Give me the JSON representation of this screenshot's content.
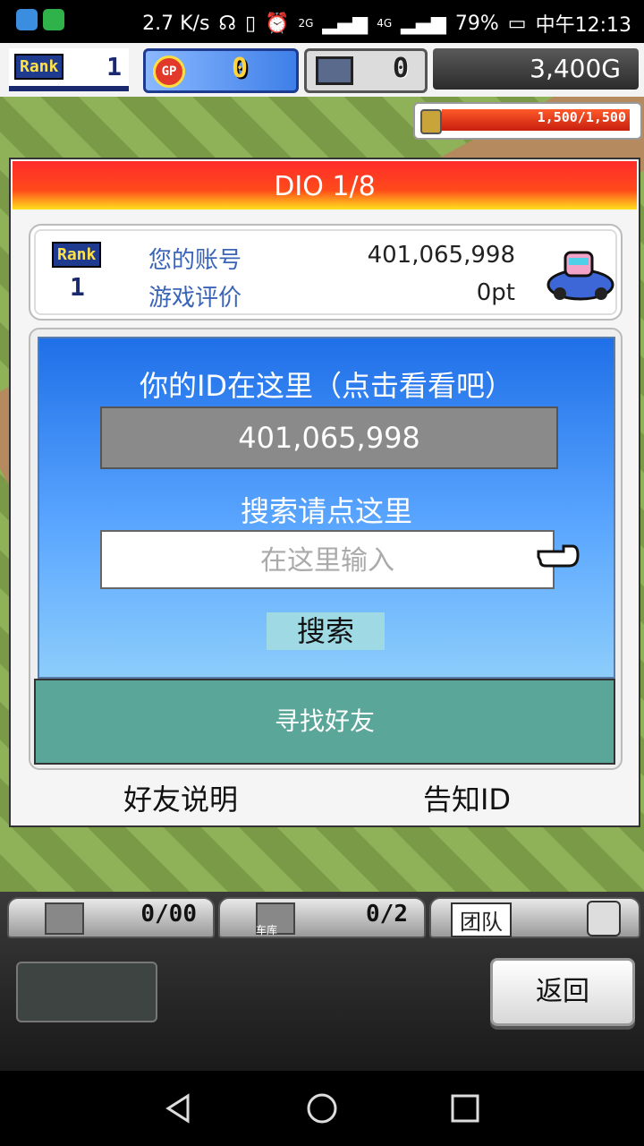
{
  "status_bar": {
    "speed": "2.7 K/s",
    "network1": "2G",
    "network2": "4G",
    "battery": "79%",
    "time": "中午12:13"
  },
  "hud": {
    "rank_label": "Rank",
    "rank_value": "1",
    "gp_label": "GP",
    "gp_value": "0",
    "pc_value": "0",
    "money": "3,400G",
    "hp": "1,500/1,500"
  },
  "dialog": {
    "title": "DIO 1/8",
    "rank_label": "Rank",
    "rank_value": "1",
    "account_label": "您的账号",
    "account_value": "401,065,998",
    "rating_label": "游戏评价",
    "rating_value": "0pt",
    "id_title": "你的ID在这里（点击看看吧）",
    "id_value": "401,065,998",
    "search_title": "搜索请点这里",
    "search_placeholder": "在这里输入",
    "search_button": "搜索",
    "find_friends": "寻找好友",
    "friend_help": "好友说明",
    "tell_id": "告知ID"
  },
  "bottom": {
    "slot1_count": "0/00",
    "slot2_label": "车库",
    "slot2_count": "0/2",
    "team_label": "团队",
    "back": "返回"
  }
}
